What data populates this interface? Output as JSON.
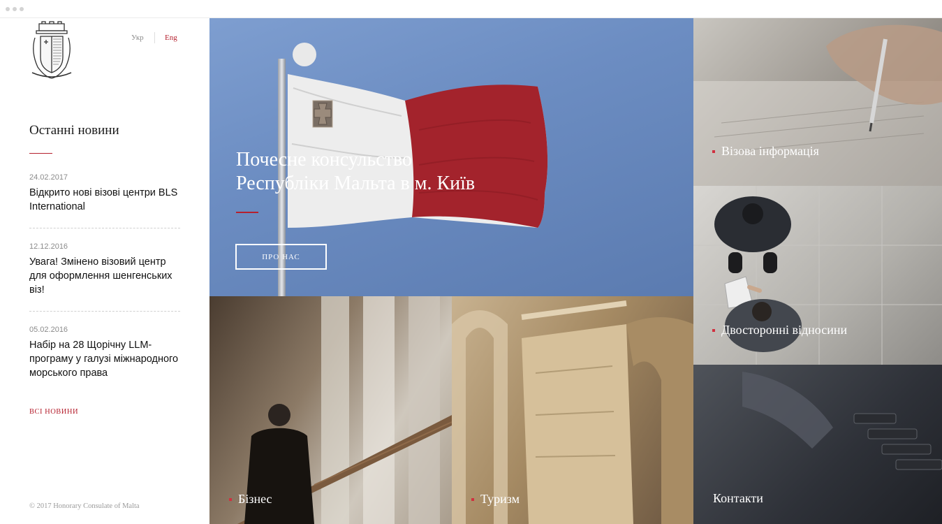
{
  "lang": {
    "ukr": "Укр",
    "eng": "Eng"
  },
  "news": {
    "title": "Останні новини",
    "items": [
      {
        "date": "24.02.2017",
        "text": "Відкрито нові візові центри BLS International"
      },
      {
        "date": "12.12.2016",
        "text": "Увага! Змінено візовий центр для оформлення шенгенських віз!"
      },
      {
        "date": "05.02.2016",
        "text": "Набір на 28 Щорічну LLM-програму у галузі міжнародного морського права"
      }
    ],
    "all_label": "ВСІ НОВИНИ"
  },
  "copyright": "© 2017 Honorary Consulate of Malta",
  "hero": {
    "title_line1": "Почесне консульство",
    "title_line2": "Республіки Мальта в м. Київ",
    "button_label": "ПРО НАС"
  },
  "tiles": {
    "visa": "Візова інформація",
    "bilateral": "Двосторонні відносини",
    "contacts": "Контакти",
    "business": "Бізнес",
    "tourism": "Туризм"
  },
  "colors": {
    "accent": "#b5202e",
    "flag_red": "#a3232c"
  },
  "icons": {
    "crest": "malta-coat-of-arms-icon"
  }
}
